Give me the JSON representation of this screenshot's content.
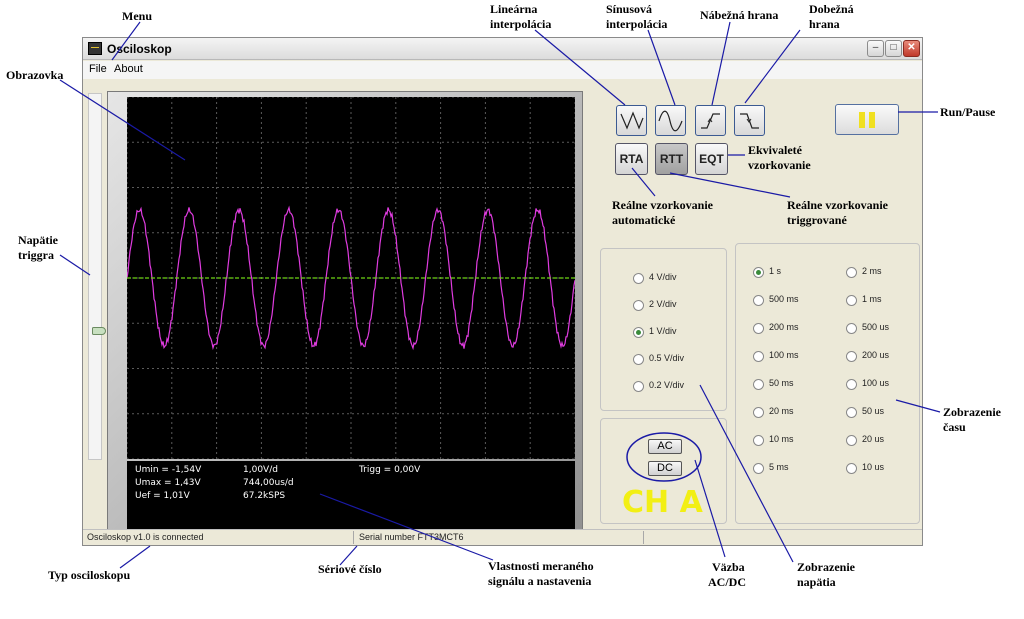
{
  "window": {
    "title": "Osciloskop"
  },
  "menu": {
    "file": "File",
    "about": "About"
  },
  "readout": {
    "umin": "Umin = -1,54V",
    "umax": "Umax = 1,43V",
    "uef": "Uef = 1,01V",
    "vdiv": "1,00V/d",
    "tdiv": "744,00us/d",
    "rate": "67.2kSPS",
    "trigg": "Trigg = 0,00V"
  },
  "waveform": {
    "color": "#e03ce0",
    "trigger_color": "#6cd414",
    "periods": 9,
    "amplitude_v": 1.5
  },
  "modes": {
    "rta": "RTA",
    "rtt": "RTT",
    "eqt": "EQT",
    "active": "RTT"
  },
  "tools": [
    "linear-interpolation-icon",
    "sine-interpolation-icon",
    "rising-edge-icon",
    "falling-edge-icon"
  ],
  "voltage": {
    "options": [
      "4 V/div",
      "2 V/div",
      "1 V/div",
      "0.5 V/div",
      "0.2 V/div"
    ],
    "selected": "1 V/div"
  },
  "time": {
    "left": [
      "1 s",
      "500 ms",
      "200 ms",
      "100 ms",
      "50 ms",
      "20 ms",
      "10 ms",
      "5 ms"
    ],
    "right": [
      "2 ms",
      "1 ms",
      "500 us",
      "200 us",
      "100 us",
      "50 us",
      "20 us",
      "10 us"
    ],
    "selected": "1 s"
  },
  "coupling": {
    "ac": "AC",
    "dc": "DC"
  },
  "channel": "CH A",
  "status": {
    "left": "Osciloskop v1.0 is connected",
    "serial": "Serial number FTT3MCT6"
  },
  "annotations": {
    "menu": "Menu",
    "linear_1": "Lineárna",
    "linear_2": "interpolácia",
    "sine_1": "Sínusová",
    "sine_2": "interpolácia",
    "rising": "Nábežná hrana",
    "falling_1": "Dobežná",
    "falling_2": "hrana",
    "screen": "Obrazovka",
    "run_pause": "Run/Pause",
    "eqt_1": "Ekvivaleté",
    "eqt_2": "vzorkovanie",
    "rta_1": "Reálne vzorkovanie",
    "rta_2": "automatické",
    "rtt_1": "Reálne vzorkovanie",
    "rtt_2": "triggrované",
    "trigger_1": "Napätie",
    "trigger_2": "triggra",
    "time_1": "Zobrazenie",
    "time_2": "času",
    "scope_type": "Typ osciloskopu",
    "serial": "Sériové číslo",
    "props_1": "Vlastnosti meraného",
    "props_2": "signálu a nastavenia",
    "coupling_1": "Väzba",
    "coupling_2": "AC/DC",
    "volt_1": "Zobrazenie",
    "volt_2": "napätia"
  },
  "colors": {
    "callout_line": "#1a1aa6",
    "screen_bg": "#000000",
    "grid": "#5a5a5a",
    "channel": "#f2ef14"
  }
}
